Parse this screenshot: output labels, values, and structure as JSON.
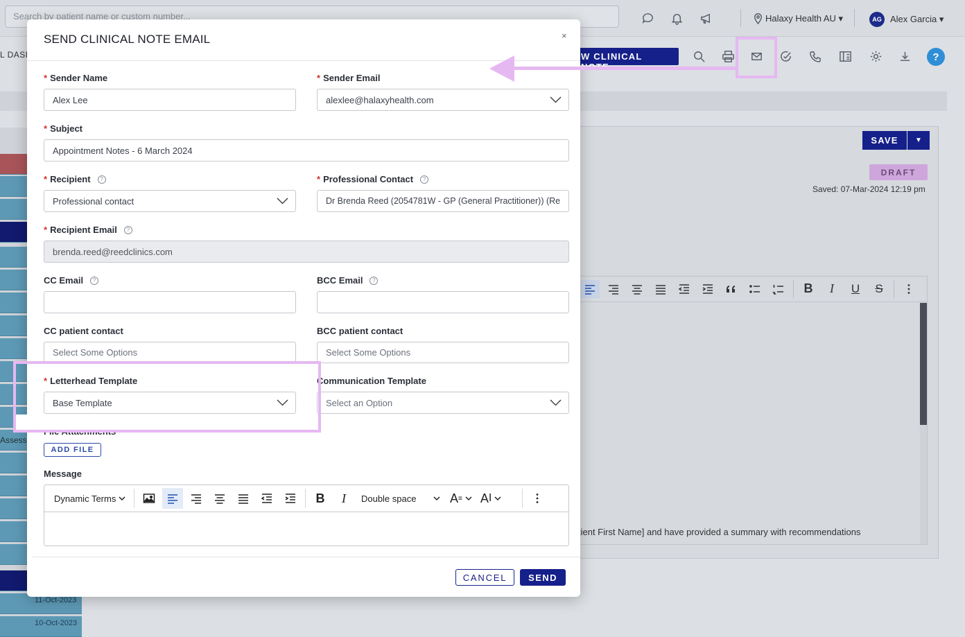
{
  "colors": {
    "accent": "#16208a",
    "highlight": "#e6b8f2",
    "required": "#d0342c"
  },
  "topbar": {
    "search_placeholder": "Search by patient name or custom number...",
    "icons": [
      "chat-icon",
      "bell-icon",
      "megaphone-icon",
      "location-pin-icon"
    ],
    "location": "Halaxy Health AU",
    "avatar_initials": "AG",
    "user_name": "Alex Garcia"
  },
  "subbar": {
    "dashboard_label": "L DASH",
    "new_note_label": "W CLINICAL NOTE",
    "icons": [
      "search-icon",
      "print-icon",
      "mail-icon",
      "check-circle-icon",
      "phone-icon",
      "calculator-icon",
      "gear-icon",
      "download-icon",
      "help-icon"
    ],
    "help_label": "?"
  },
  "note": {
    "save_label": "SAVE",
    "status": "DRAFT",
    "saved_text": "Saved: 07-Mar-2024 12:19 pm",
    "editor_text": "tient First Name] and have provided a summary with recommendations"
  },
  "sidebar": {
    "assess_label": "Assess",
    "dates": [
      "11-Oct-2023",
      "10-Oct-2023"
    ]
  },
  "modal": {
    "title": "SEND CLINICAL NOTE EMAIL",
    "close": "×",
    "sender_name": {
      "label": "Sender Name",
      "value": "Alex Lee"
    },
    "sender_email": {
      "label": "Sender Email",
      "value": "alexlee@halaxyhealth.com"
    },
    "subject": {
      "label": "Subject",
      "value": "Appointment Notes - 6 March 2024"
    },
    "recipient": {
      "label": "Recipient",
      "value": "Professional contact"
    },
    "professional_contact": {
      "label": "Professional Contact",
      "value": "Dr Brenda Reed (2054781W - GP (General Practitioner)) (Re"
    },
    "recipient_email": {
      "label": "Recipient Email",
      "value": "brenda.reed@reedclinics.com"
    },
    "cc_email": {
      "label": "CC Email",
      "value": ""
    },
    "bcc_email": {
      "label": "BCC Email",
      "value": ""
    },
    "cc_patient_contact": {
      "label": "CC patient contact",
      "placeholder": "Select Some Options"
    },
    "bcc_patient_contact": {
      "label": "BCC patient contact",
      "placeholder": "Select Some Options"
    },
    "letterhead_template": {
      "label": "Letterhead Template",
      "value": "Base Template"
    },
    "communication_template": {
      "label": "Communication Template",
      "placeholder": "Select an Option"
    },
    "file_attachments": {
      "label": "File Attachments",
      "button": "ADD FILE"
    },
    "message": {
      "label": "Message",
      "dynamic_terms": "Dynamic Terms",
      "line_spacing": "Double space",
      "font_size_glyph": "A",
      "toolbar_icons": [
        "image-icon",
        "align-left-icon",
        "align-right-icon",
        "align-center-icon",
        "align-justify-icon",
        "outdent-icon",
        "indent-icon",
        "bold-icon",
        "italic-icon",
        "font-color-icon",
        "font-size-icon",
        "more-vertical-icon"
      ]
    },
    "cancel_label": "CANCEL",
    "send_label": "SEND"
  }
}
